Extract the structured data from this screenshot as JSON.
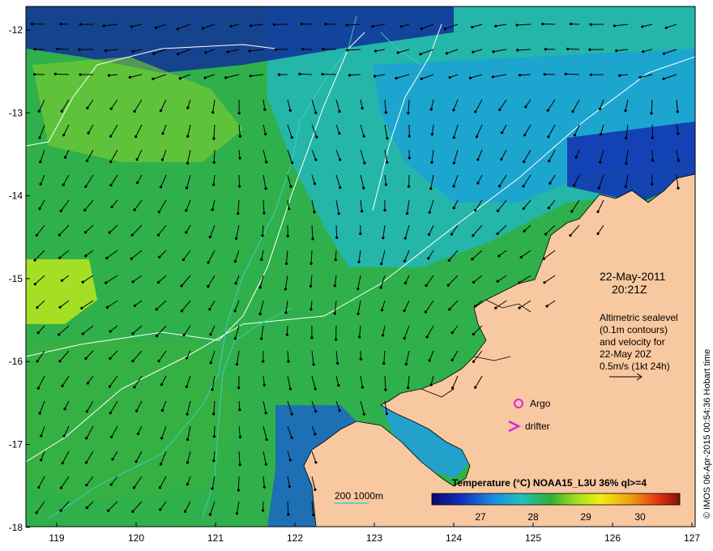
{
  "map": {
    "x_ticks": [
      "119",
      "120",
      "121",
      "122",
      "123",
      "124",
      "125",
      "126",
      "127"
    ],
    "y_ticks": [
      "-12",
      "-13",
      "-14",
      "-15",
      "-16",
      "-17",
      "-18"
    ],
    "date": "22-May-2011",
    "time": "20:21Z",
    "description_lines": [
      "Altimetric sealevel",
      "(0.1m contours)",
      "and velocity for",
      "22-May 20Z",
      "0.5m/s (1kt 24h)"
    ],
    "legend": {
      "argo_label": "Argo",
      "drifter_label": "drifter",
      "argo_color": "#e020e0",
      "drifter_color": "#e020e0"
    },
    "depth_contour_label": "200  1000m",
    "depth_contour_color": "#40d0d0",
    "colorbar": {
      "title": "Temperature (°C) NOAA15_L3U 36% ql>=4",
      "tick_labels": [
        "27",
        "28",
        "29",
        "30"
      ]
    },
    "credit": "© IMOS 06-Apr-2015 00:54:36 Hobart time",
    "colors": {
      "land": "#f8c8a0",
      "ocean_warm": "#30b030",
      "ocean_cool": "#20a0e0",
      "ocean_cold": "#1030a0",
      "sealevel_contour": "#ffffff",
      "velocity_arrow": "#000000"
    }
  }
}
